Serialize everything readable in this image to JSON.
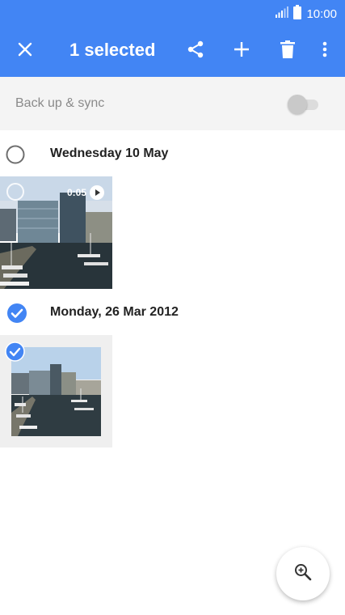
{
  "status_bar": {
    "time": "10:00",
    "icons": [
      "signal-icon",
      "battery-icon"
    ]
  },
  "app_bar": {
    "title": "1 selected",
    "actions": [
      "close-icon",
      "share-icon",
      "add-icon",
      "delete-icon",
      "more-vert-icon"
    ]
  },
  "sync": {
    "label": "Back up & sync",
    "enabled": false
  },
  "groups": [
    {
      "date": "Wednesday 10 May",
      "selected": false,
      "items": [
        {
          "type": "video",
          "duration": "0:05",
          "selected": false
        }
      ]
    },
    {
      "date": "Monday, 26 Mar 2012",
      "selected": true,
      "items": [
        {
          "type": "photo",
          "selected": true
        }
      ]
    }
  ],
  "fab": {
    "icon": "zoom-in-icon"
  },
  "colors": {
    "accent": "#4285f4",
    "header_bg": "#4285f4",
    "sync_bg": "#f4f4f4"
  }
}
